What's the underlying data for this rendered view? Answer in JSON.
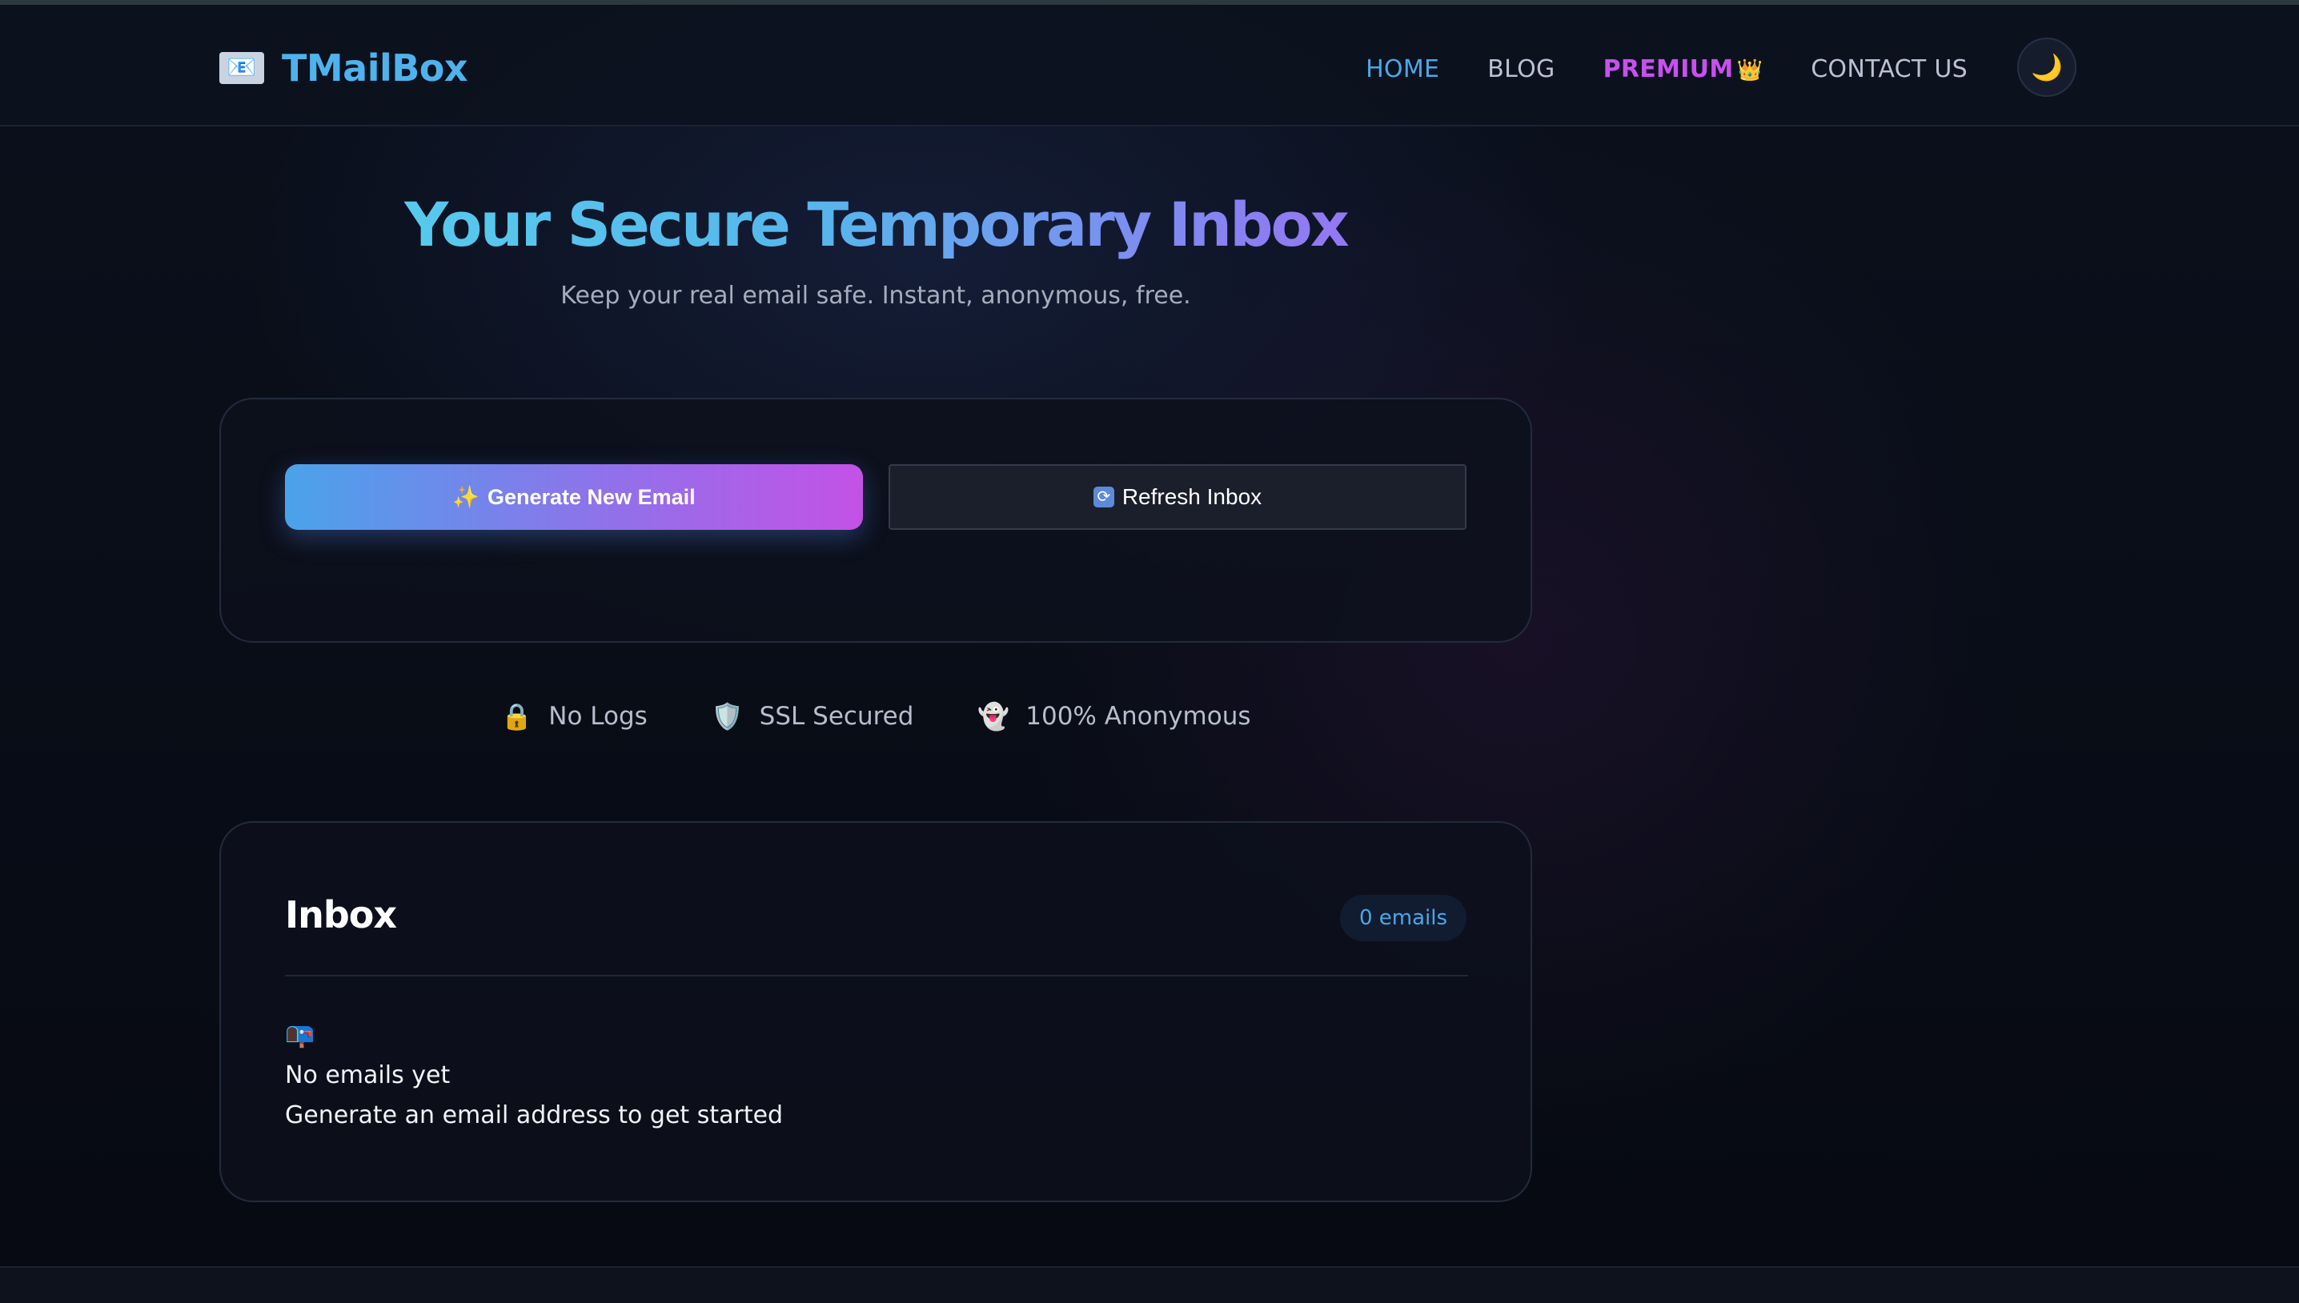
{
  "header": {
    "logo_icon": "📧",
    "logo_text": "TMailBox",
    "nav": {
      "home": "HOME",
      "blog": "BLOG",
      "premium": "PREMIUM",
      "premium_icon": "👑",
      "contact": "CONTACT US"
    },
    "theme_icon": "🌙"
  },
  "hero": {
    "title": "Your Secure Temporary Inbox",
    "subtitle": "Keep your real email safe. Instant, anonymous, free."
  },
  "actions": {
    "generate_icon": "✨",
    "generate_label": "Generate New Email",
    "refresh_icon": "🔄",
    "refresh_label": "Refresh Inbox"
  },
  "features": [
    {
      "icon": "🔒",
      "label": "No Logs"
    },
    {
      "icon": "🛡️",
      "label": "SSL Secured"
    },
    {
      "icon": "👻",
      "label": "100% Anonymous"
    }
  ],
  "inbox": {
    "title": "Inbox",
    "count": "0 emails",
    "empty_icon": "📭",
    "empty_title": "No emails yet",
    "empty_subtitle": "Generate an email address to get started"
  },
  "colors": {
    "accent_blue": "#4ba7ea",
    "accent_purple": "#c94ff0",
    "background": "#070b13"
  }
}
